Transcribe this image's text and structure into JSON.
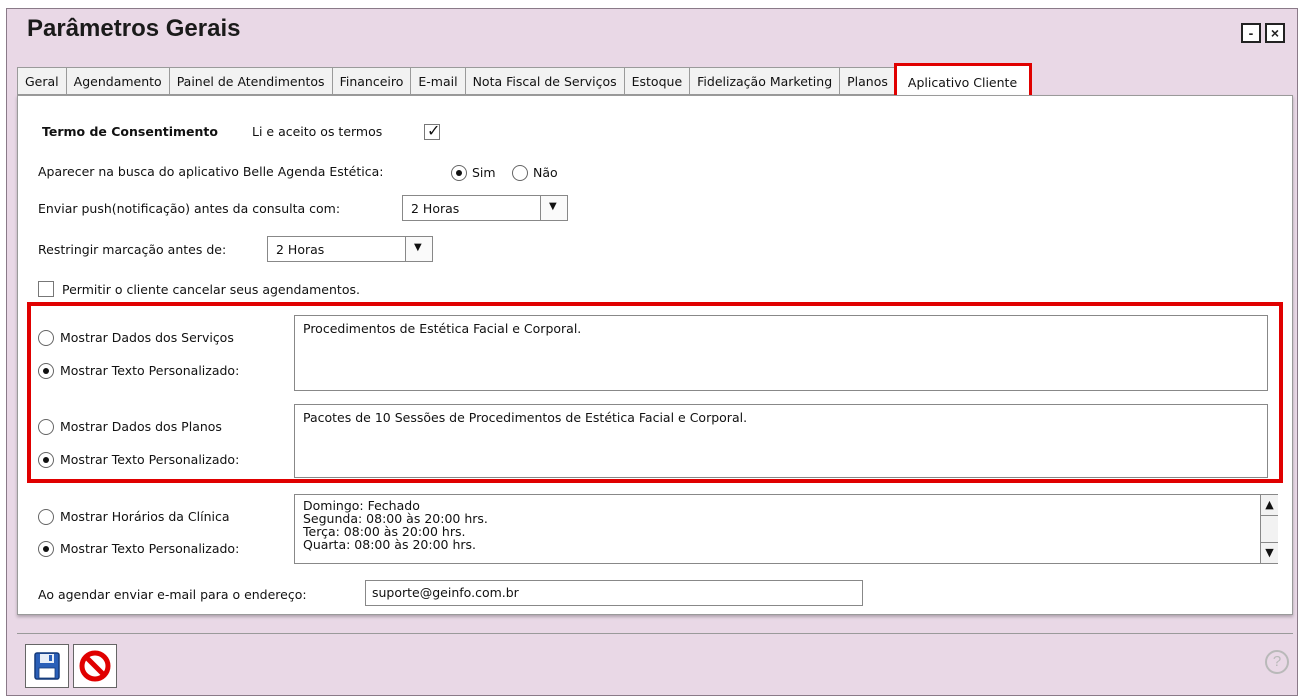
{
  "window": {
    "title": "Parâmetros Gerais",
    "minimize_label": "-",
    "close_label": "×"
  },
  "tabs": [
    {
      "label": "Geral",
      "active": false
    },
    {
      "label": "Agendamento",
      "active": false
    },
    {
      "label": "Painel de Atendimentos",
      "active": false
    },
    {
      "label": "Financeiro",
      "active": false
    },
    {
      "label": "E-mail",
      "active": false
    },
    {
      "label": "Nota Fiscal de Serviços",
      "active": false
    },
    {
      "label": "Estoque",
      "active": false
    },
    {
      "label": "Fidelização Marketing",
      "active": false
    },
    {
      "label": "Planos",
      "active": false
    },
    {
      "label": "Aplicativo Cliente",
      "active": true
    }
  ],
  "consent": {
    "heading": "Termo de Consentimento",
    "label": "Li e aceito os termos",
    "checked": true,
    "mark": "✓"
  },
  "search_visibility": {
    "label": "Aparecer na busca do aplicativo Belle Agenda Estética:",
    "yes": "Sim",
    "no": "Não",
    "selected": "Sim"
  },
  "push": {
    "label": "Enviar push(notificação) antes da consulta com:",
    "value": "2 Horas"
  },
  "restrict": {
    "label": "Restringir marcação antes de:",
    "value": "2 Horas"
  },
  "allow_cancel": {
    "label": "Permitir o cliente cancelar seus agendamentos.",
    "checked": false
  },
  "services": {
    "option_data": "Mostrar Dados dos Serviços",
    "option_custom": "Mostrar Texto Personalizado:",
    "text": "Procedimentos de Estética Facial e Corporal."
  },
  "plans": {
    "option_data": "Mostrar Dados dos Planos",
    "option_custom": "Mostrar Texto Personalizado:",
    "text": "Pacotes de 10 Sessões de Procedimentos de Estética Facial e Corporal."
  },
  "hours": {
    "option_data": "Mostrar Horários da Clínica",
    "option_custom": "Mostrar Texto Personalizado:",
    "text": "Domingo: Fechado\nSegunda: 08:00 às 20:00 hrs.\nTerça: 08:00 às 20:00 hrs.\nQuarta: 08:00 às 20:00 hrs."
  },
  "email": {
    "label": "Ao agendar enviar e-mail para o endereço:",
    "value": "suporte@geinfo.com.br"
  },
  "colors": {
    "highlight": "#e00000",
    "window_bg": "#e9d8e6"
  },
  "icons": {
    "save": "floppy-disk-icon",
    "cancel": "no-entry-icon",
    "help": "question-circle-icon"
  },
  "help_label": "?"
}
